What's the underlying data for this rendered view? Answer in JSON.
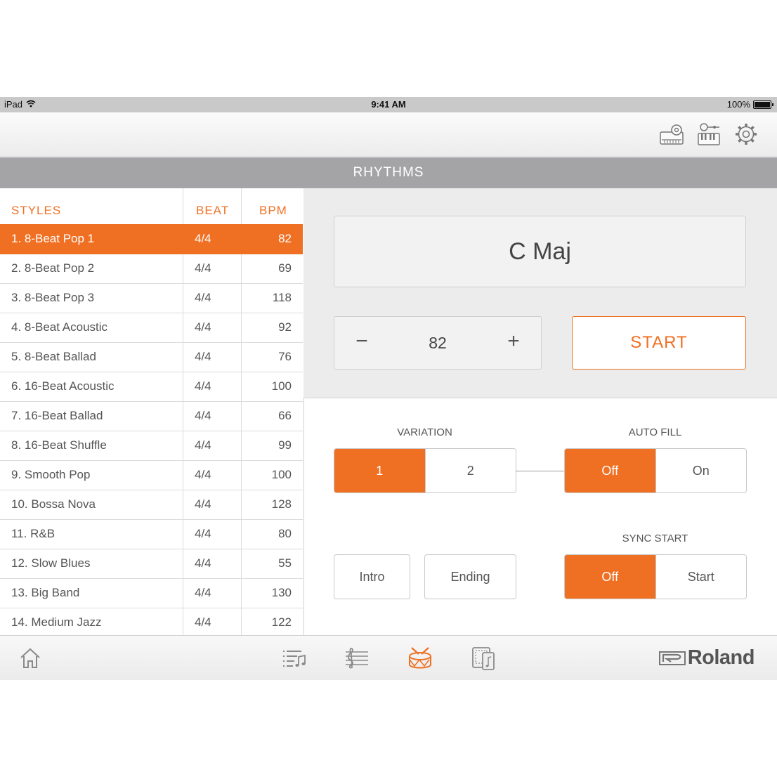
{
  "status_bar": {
    "device": "iPad",
    "time": "9:41 AM",
    "battery": "100%"
  },
  "toolbar": {
    "icons": [
      "keyboard-settings-icon",
      "instrument-settings-icon",
      "gear-icon"
    ]
  },
  "section": {
    "title": "RHYTHMS"
  },
  "list": {
    "headers": {
      "style": "STYLES",
      "beat": "BEAT",
      "bpm": "BPM"
    },
    "selected_index": 0,
    "rows": [
      {
        "style": "1.  8-Beat Pop 1",
        "beat": "4/4",
        "bpm": "82"
      },
      {
        "style": "2.  8-Beat Pop 2",
        "beat": "4/4",
        "bpm": "69"
      },
      {
        "style": "3.  8-Beat Pop 3",
        "beat": "4/4",
        "bpm": "118"
      },
      {
        "style": "4.  8-Beat Acoustic",
        "beat": "4/4",
        "bpm": "92"
      },
      {
        "style": "5.  8-Beat Ballad",
        "beat": "4/4",
        "bpm": "76"
      },
      {
        "style": "6.  16-Beat Acoustic",
        "beat": "4/4",
        "bpm": "100"
      },
      {
        "style": "7.  16-Beat Ballad",
        "beat": "4/4",
        "bpm": "66"
      },
      {
        "style": "8.  16-Beat Shuffle",
        "beat": "4/4",
        "bpm": "99"
      },
      {
        "style": "9.  Smooth Pop",
        "beat": "4/4",
        "bpm": "100"
      },
      {
        "style": "10.  Bossa Nova",
        "beat": "4/4",
        "bpm": "128"
      },
      {
        "style": "11.  R&B",
        "beat": "4/4",
        "bpm": "80"
      },
      {
        "style": "12.  Slow Blues",
        "beat": "4/4",
        "bpm": "55"
      },
      {
        "style": "13.  Big Band",
        "beat": "4/4",
        "bpm": "130"
      },
      {
        "style": "14.  Medium Jazz",
        "beat": "4/4",
        "bpm": "122"
      }
    ]
  },
  "player": {
    "chord": "C Maj",
    "tempo": {
      "minus": "−",
      "value": "82",
      "plus": "+"
    },
    "start_label": "START"
  },
  "variation": {
    "label": "VARIATION",
    "options": [
      "1",
      "2"
    ],
    "selected": "1"
  },
  "auto_fill": {
    "label": "AUTO FILL",
    "options": [
      "Off",
      "On"
    ],
    "selected": "Off"
  },
  "sync_start": {
    "label": "SYNC START",
    "options": [
      "Off",
      "Start"
    ],
    "selected": "Off"
  },
  "buttons": {
    "intro": "Intro",
    "ending": "Ending"
  },
  "nav": {
    "icons": [
      "home-icon",
      "playlist-icon",
      "score-icon",
      "drum-icon",
      "tablet-score-icon"
    ],
    "active": "drum-icon",
    "brand": "Roland",
    "accent_color": "#f07023"
  }
}
